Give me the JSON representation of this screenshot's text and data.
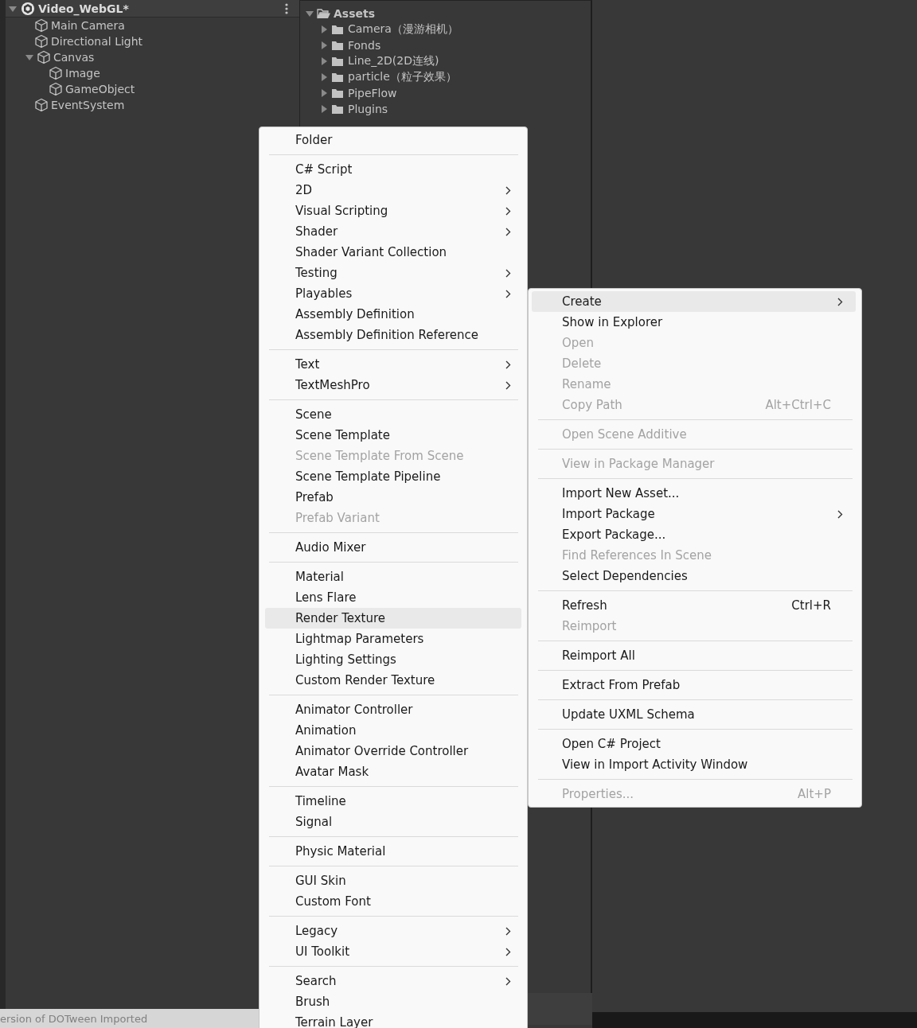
{
  "hierarchy": {
    "scene": {
      "title": "Video_WebGL*",
      "expanded": true,
      "children": [
        {
          "label": "Main Camera"
        },
        {
          "label": "Directional Light"
        },
        {
          "label": "Canvas",
          "expanded": true,
          "children": [
            {
              "label": "Image"
            },
            {
              "label": "GameObject"
            }
          ]
        },
        {
          "label": "EventSystem"
        }
      ]
    }
  },
  "project": {
    "root": {
      "label": "Assets",
      "expanded": true,
      "children": [
        {
          "label": "Camera（漫游相机）",
          "expanded": false
        },
        {
          "label": "Fonds",
          "expanded": false
        },
        {
          "label": "Line_2D(2D连线)",
          "expanded": false
        },
        {
          "label": "particle（粒子效果）",
          "expanded": false
        },
        {
          "label": "PipeFlow",
          "expanded": false
        },
        {
          "label": "Plugins",
          "expanded": false
        }
      ]
    }
  },
  "status_bar": {
    "message": "ersion of DOTween Imported"
  },
  "create_menu": {
    "items": [
      {
        "kind": "item",
        "label": "Folder",
        "submenu": false,
        "disabled": false,
        "selected": false
      },
      {
        "kind": "separator"
      },
      {
        "kind": "item",
        "label": "C# Script",
        "submenu": false,
        "disabled": false,
        "selected": false
      },
      {
        "kind": "item",
        "label": "2D",
        "submenu": true,
        "disabled": false,
        "selected": false
      },
      {
        "kind": "item",
        "label": "Visual Scripting",
        "submenu": true,
        "disabled": false,
        "selected": false
      },
      {
        "kind": "item",
        "label": "Shader",
        "submenu": true,
        "disabled": false,
        "selected": false
      },
      {
        "kind": "item",
        "label": "Shader Variant Collection",
        "submenu": false,
        "disabled": false,
        "selected": false
      },
      {
        "kind": "item",
        "label": "Testing",
        "submenu": true,
        "disabled": false,
        "selected": false
      },
      {
        "kind": "item",
        "label": "Playables",
        "submenu": true,
        "disabled": false,
        "selected": false
      },
      {
        "kind": "item",
        "label": "Assembly Definition",
        "submenu": false,
        "disabled": false,
        "selected": false
      },
      {
        "kind": "item",
        "label": "Assembly Definition Reference",
        "submenu": false,
        "disabled": false,
        "selected": false
      },
      {
        "kind": "separator"
      },
      {
        "kind": "item",
        "label": "Text",
        "submenu": true,
        "disabled": false,
        "selected": false
      },
      {
        "kind": "item",
        "label": "TextMeshPro",
        "submenu": true,
        "disabled": false,
        "selected": false
      },
      {
        "kind": "separator"
      },
      {
        "kind": "item",
        "label": "Scene",
        "submenu": false,
        "disabled": false,
        "selected": false
      },
      {
        "kind": "item",
        "label": "Scene Template",
        "submenu": false,
        "disabled": false,
        "selected": false
      },
      {
        "kind": "item",
        "label": "Scene Template From Scene",
        "submenu": false,
        "disabled": true,
        "selected": false
      },
      {
        "kind": "item",
        "label": "Scene Template Pipeline",
        "submenu": false,
        "disabled": false,
        "selected": false
      },
      {
        "kind": "item",
        "label": "Prefab",
        "submenu": false,
        "disabled": false,
        "selected": false
      },
      {
        "kind": "item",
        "label": "Prefab Variant",
        "submenu": false,
        "disabled": true,
        "selected": false
      },
      {
        "kind": "separator"
      },
      {
        "kind": "item",
        "label": "Audio Mixer",
        "submenu": false,
        "disabled": false,
        "selected": false
      },
      {
        "kind": "separator"
      },
      {
        "kind": "item",
        "label": "Material",
        "submenu": false,
        "disabled": false,
        "selected": false
      },
      {
        "kind": "item",
        "label": "Lens Flare",
        "submenu": false,
        "disabled": false,
        "selected": false
      },
      {
        "kind": "item",
        "label": "Render Texture",
        "submenu": false,
        "disabled": false,
        "selected": true
      },
      {
        "kind": "item",
        "label": "Lightmap Parameters",
        "submenu": false,
        "disabled": false,
        "selected": false
      },
      {
        "kind": "item",
        "label": "Lighting Settings",
        "submenu": false,
        "disabled": false,
        "selected": false
      },
      {
        "kind": "item",
        "label": "Custom Render Texture",
        "submenu": false,
        "disabled": false,
        "selected": false
      },
      {
        "kind": "separator"
      },
      {
        "kind": "item",
        "label": "Animator Controller",
        "submenu": false,
        "disabled": false,
        "selected": false
      },
      {
        "kind": "item",
        "label": "Animation",
        "submenu": false,
        "disabled": false,
        "selected": false
      },
      {
        "kind": "item",
        "label": "Animator Override Controller",
        "submenu": false,
        "disabled": false,
        "selected": false
      },
      {
        "kind": "item",
        "label": "Avatar Mask",
        "submenu": false,
        "disabled": false,
        "selected": false
      },
      {
        "kind": "separator"
      },
      {
        "kind": "item",
        "label": "Timeline",
        "submenu": false,
        "disabled": false,
        "selected": false
      },
      {
        "kind": "item",
        "label": "Signal",
        "submenu": false,
        "disabled": false,
        "selected": false
      },
      {
        "kind": "separator"
      },
      {
        "kind": "item",
        "label": "Physic Material",
        "submenu": false,
        "disabled": false,
        "selected": false
      },
      {
        "kind": "separator"
      },
      {
        "kind": "item",
        "label": "GUI Skin",
        "submenu": false,
        "disabled": false,
        "selected": false
      },
      {
        "kind": "item",
        "label": "Custom Font",
        "submenu": false,
        "disabled": false,
        "selected": false
      },
      {
        "kind": "separator"
      },
      {
        "kind": "item",
        "label": "Legacy",
        "submenu": true,
        "disabled": false,
        "selected": false
      },
      {
        "kind": "item",
        "label": "UI Toolkit",
        "submenu": true,
        "disabled": false,
        "selected": false
      },
      {
        "kind": "separator"
      },
      {
        "kind": "item",
        "label": "Search",
        "submenu": true,
        "disabled": false,
        "selected": false
      },
      {
        "kind": "item",
        "label": "Brush",
        "submenu": false,
        "disabled": false,
        "selected": false
      },
      {
        "kind": "item",
        "label": "Terrain Layer",
        "submenu": false,
        "disabled": false,
        "selected": false
      }
    ]
  },
  "context_menu": {
    "items": [
      {
        "kind": "item",
        "label": "Create",
        "submenu": true,
        "disabled": false,
        "selected": true
      },
      {
        "kind": "item",
        "label": "Show in Explorer",
        "submenu": false,
        "disabled": false,
        "selected": false
      },
      {
        "kind": "item",
        "label": "Open",
        "submenu": false,
        "disabled": true,
        "selected": false
      },
      {
        "kind": "item",
        "label": "Delete",
        "submenu": false,
        "disabled": true,
        "selected": false
      },
      {
        "kind": "item",
        "label": "Rename",
        "submenu": false,
        "disabled": true,
        "selected": false
      },
      {
        "kind": "item",
        "label": "Copy Path",
        "submenu": false,
        "disabled": true,
        "selected": false,
        "shortcut": "Alt+Ctrl+C"
      },
      {
        "kind": "separator"
      },
      {
        "kind": "item",
        "label": "Open Scene Additive",
        "submenu": false,
        "disabled": true,
        "selected": false
      },
      {
        "kind": "separator"
      },
      {
        "kind": "item",
        "label": "View in Package Manager",
        "submenu": false,
        "disabled": true,
        "selected": false
      },
      {
        "kind": "separator"
      },
      {
        "kind": "item",
        "label": "Import New Asset...",
        "submenu": false,
        "disabled": false,
        "selected": false
      },
      {
        "kind": "item",
        "label": "Import Package",
        "submenu": true,
        "disabled": false,
        "selected": false
      },
      {
        "kind": "item",
        "label": "Export Package...",
        "submenu": false,
        "disabled": false,
        "selected": false
      },
      {
        "kind": "item",
        "label": "Find References In Scene",
        "submenu": false,
        "disabled": true,
        "selected": false
      },
      {
        "kind": "item",
        "label": "Select Dependencies",
        "submenu": false,
        "disabled": false,
        "selected": false
      },
      {
        "kind": "separator"
      },
      {
        "kind": "item",
        "label": "Refresh",
        "submenu": false,
        "disabled": false,
        "selected": false,
        "shortcut": "Ctrl+R"
      },
      {
        "kind": "item",
        "label": "Reimport",
        "submenu": false,
        "disabled": true,
        "selected": false
      },
      {
        "kind": "separator"
      },
      {
        "kind": "item",
        "label": "Reimport All",
        "submenu": false,
        "disabled": false,
        "selected": false
      },
      {
        "kind": "separator"
      },
      {
        "kind": "item",
        "label": "Extract From Prefab",
        "submenu": false,
        "disabled": false,
        "selected": false
      },
      {
        "kind": "separator"
      },
      {
        "kind": "item",
        "label": "Update UXML Schema",
        "submenu": false,
        "disabled": false,
        "selected": false
      },
      {
        "kind": "separator"
      },
      {
        "kind": "item",
        "label": "Open C# Project",
        "submenu": false,
        "disabled": false,
        "selected": false
      },
      {
        "kind": "item",
        "label": "View in Import Activity Window",
        "submenu": false,
        "disabled": false,
        "selected": false
      },
      {
        "kind": "separator"
      },
      {
        "kind": "item",
        "label": "Properties...",
        "submenu": false,
        "disabled": true,
        "selected": false,
        "shortcut": "Alt+P"
      }
    ]
  }
}
